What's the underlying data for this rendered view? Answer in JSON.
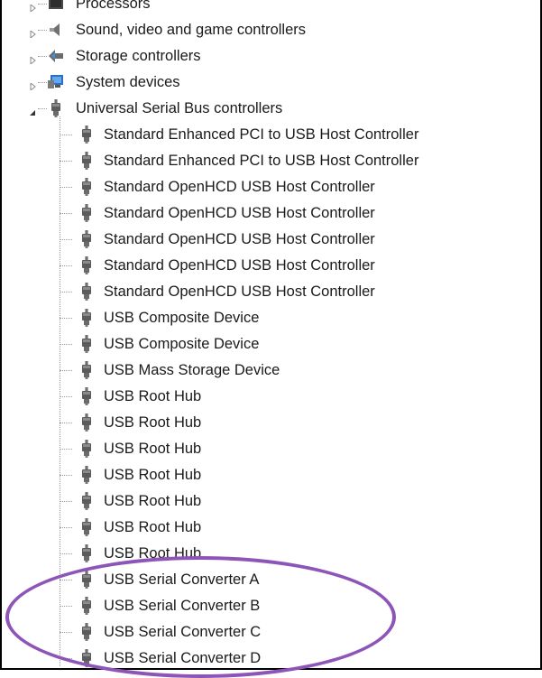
{
  "tree": {
    "top_categories": [
      {
        "label": "Processors",
        "icon": "processor-icon",
        "expanded": false
      },
      {
        "label": "Sound, video and game controllers",
        "icon": "speaker-icon",
        "expanded": false
      },
      {
        "label": "Storage controllers",
        "icon": "storage-controller-icon",
        "expanded": false
      },
      {
        "label": "System devices",
        "icon": "system-devices-icon",
        "expanded": false
      },
      {
        "label": "Universal Serial Bus controllers",
        "icon": "usb-plug-icon",
        "expanded": true
      }
    ],
    "usb_children": [
      {
        "label": "Standard Enhanced PCI to USB Host Controller",
        "icon": "usb-plug-icon"
      },
      {
        "label": "Standard Enhanced PCI to USB Host Controller",
        "icon": "usb-plug-icon"
      },
      {
        "label": "Standard OpenHCD USB Host Controller",
        "icon": "usb-plug-icon"
      },
      {
        "label": "Standard OpenHCD USB Host Controller",
        "icon": "usb-plug-icon"
      },
      {
        "label": "Standard OpenHCD USB Host Controller",
        "icon": "usb-plug-icon"
      },
      {
        "label": "Standard OpenHCD USB Host Controller",
        "icon": "usb-plug-icon"
      },
      {
        "label": "Standard OpenHCD USB Host Controller",
        "icon": "usb-plug-icon"
      },
      {
        "label": "USB Composite Device",
        "icon": "usb-plug-icon"
      },
      {
        "label": "USB Composite Device",
        "icon": "usb-plug-icon"
      },
      {
        "label": "USB Mass Storage Device",
        "icon": "usb-plug-icon"
      },
      {
        "label": "USB Root Hub",
        "icon": "usb-plug-icon"
      },
      {
        "label": "USB Root Hub",
        "icon": "usb-plug-icon"
      },
      {
        "label": "USB Root Hub",
        "icon": "usb-plug-icon"
      },
      {
        "label": "USB Root Hub",
        "icon": "usb-plug-icon"
      },
      {
        "label": "USB Root Hub",
        "icon": "usb-plug-icon"
      },
      {
        "label": "USB Root Hub",
        "icon": "usb-plug-icon"
      },
      {
        "label": "USB Root Hub",
        "icon": "usb-plug-icon"
      },
      {
        "label": "USB Serial Converter A",
        "icon": "usb-plug-icon"
      },
      {
        "label": "USB Serial Converter B",
        "icon": "usb-plug-icon"
      },
      {
        "label": "USB Serial Converter C",
        "icon": "usb-plug-icon"
      },
      {
        "label": "USB Serial Converter D",
        "icon": "usb-plug-icon"
      }
    ]
  },
  "annotation": {
    "color": "#8e55b8",
    "shape": "ellipse-around-serial-converters"
  }
}
